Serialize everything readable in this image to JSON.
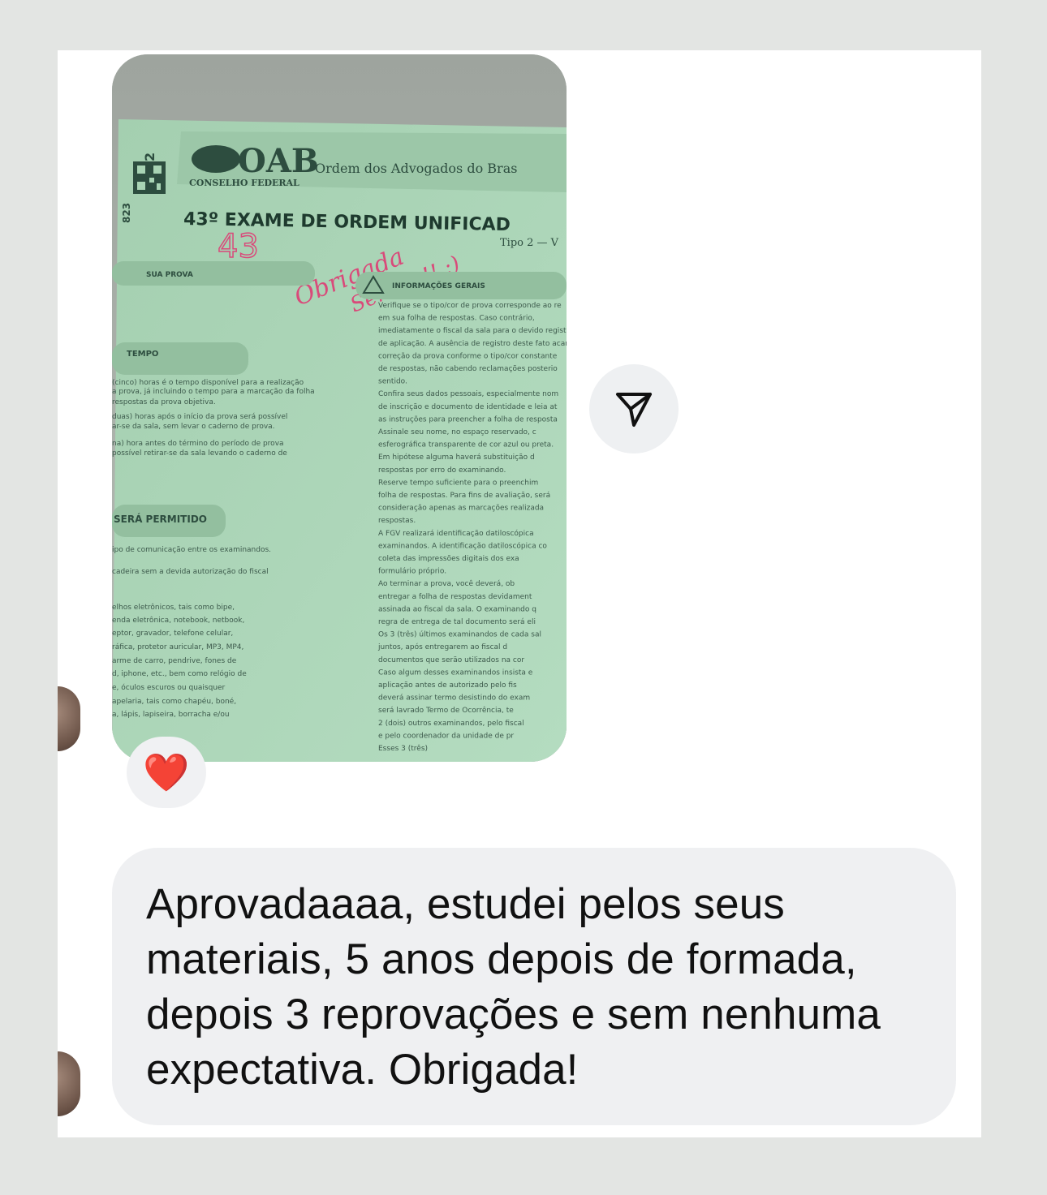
{
  "chat": {
    "photo": {
      "header_org": "Ordem dos Advogados do Bras",
      "logo_text": "OAB",
      "conselho": "CONSELHO FEDERAL",
      "exam_title": "43º EXAME DE ORDEM UNIFICAD",
      "tipo": "Tipo 2 — V",
      "qr_number": "823",
      "corner_digit": "2",
      "handwritten_number": "43",
      "handwritten_line1": "Obrigada",
      "handwritten_line2": "Senhor!! :)",
      "section_sua_prova": "SUA PROVA",
      "section_tempo": "TEMPO",
      "section_nao_permitido": "SERÁ PERMITIDO",
      "section_info": "INFORMAÇÕES GERAIS",
      "left_text": [
        "(cinco) horas é o tempo disponível para a realização",
        "a prova, já incluindo o tempo para a marcação da folha",
        "respostas da prova objetiva.",
        "duas) horas após o início da prova será possível",
        "ar-se da sala, sem levar o caderno de prova.",
        "na) hora antes do término do período de prova",
        "possível retirar-se da sala levando o caderno de",
        "ipo de comunicação entre os examinandos.",
        "cadeira sem a devida autorização do fiscal",
        "elhos eletrônicos, tais como bipe,",
        "enda eletrônica, notebook, netbook,",
        "eptor, gravador, telefone celular,",
        "ráfica, protetor auricular, MP3, MP4,",
        "arme de carro, pendrive, fones de",
        "d, iphone, etc., bem como relógio de",
        "e, óculos escuros ou quaisquer",
        "apelaria, tais como chapéu, boné,",
        "a, lápis, lapiseira, borracha e/ou"
      ],
      "right_text": [
        "Verifique se o tipo/cor de prova corresponde ao re",
        "em sua folha de respostas. Caso contrário,",
        "imediatamente o fiscal da sala para o devido regist",
        "de aplicação. A ausência de registro deste fato acar",
        "correção da prova conforme o tipo/cor constante",
        "de respostas, não cabendo reclamações posterio",
        "sentido.",
        "Confira seus dados pessoais, especialmente nom",
        "de inscrição e documento de identidade e leia at",
        "as instruções para preencher a folha de resposta",
        "Assinale seu nome, no espaço reservado, c",
        "esferográfica transparente de cor azul ou preta.",
        "Em hipótese alguma haverá substituição d",
        "respostas por erro do examinando.",
        "Reserve tempo suficiente para o preenchim",
        "folha de respostas. Para fins de avaliação, será",
        "consideração apenas as marcações realizada",
        "respostas.",
        "A FGV realizará identificação datiloscópica",
        "examinandos. A identificação datiloscópica co",
        "coleta das impressões digitais dos exa",
        "formulário próprio.",
        "Ao terminar a prova, você deverá, ob",
        "entregar a folha de respostas devidament",
        "assinada ao fiscal da sala. O examinando q",
        "regra de entrega de tal documento será eli",
        "Os 3 (três) últimos examinandos de cada sal",
        "juntos, após entregarem ao fiscal d",
        "documentos que serão utilizados na cor",
        "Caso algum desses examinandos insista e",
        "aplicação antes de autorizado pelo fis",
        "deverá assinar termo desistindo do exam",
        "será lavrado Termo de Ocorrência, te",
        "2 (dois) outros examinandos, pelo fiscal",
        "e pelo coordenador da unidade de pr",
        "Esses 3 (três)"
      ]
    },
    "reaction_icon": "red-heart",
    "reaction_emoji": "❤️",
    "share_icon": "paper-plane-icon",
    "message": "Aprovadaaaa, estudei pelos seus materiais, 5 anos depois de formada, depois 3 reprovações e sem nenhuma expectativa. Obrigada!"
  },
  "colors": {
    "page_bg": "#e3e5e3",
    "card_bg": "#ffffff",
    "bubble_bg": "#eff0f2",
    "paper_green": "#a9d4b4",
    "ink_red": "#d94a7a"
  }
}
